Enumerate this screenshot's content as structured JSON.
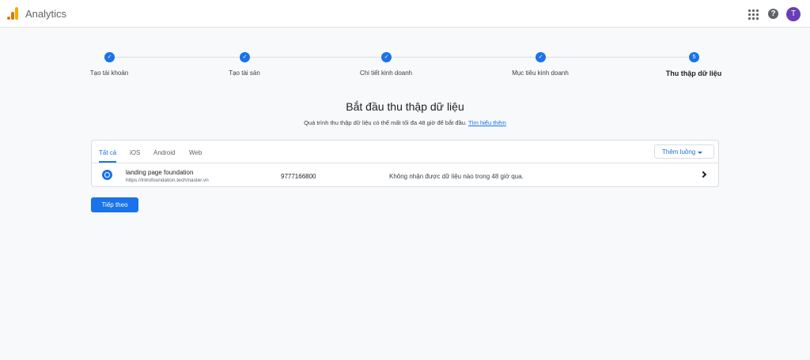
{
  "header": {
    "app_title": "Analytics",
    "avatar_initial": "T",
    "help_glyph": "?",
    "icons": [
      "analytics-logo-icon",
      "apps-grid-icon",
      "help-icon"
    ]
  },
  "stepper": {
    "check_glyph": "✓",
    "steps": [
      {
        "label": "Tạo tài khoản",
        "state": "done"
      },
      {
        "label": "Tạo tài sản",
        "state": "done"
      },
      {
        "label": "Chi tiết kinh doanh",
        "state": "done"
      },
      {
        "label": "Mục tiêu kinh doanh",
        "state": "done"
      },
      {
        "label": "Thu thập dữ liệu",
        "state": "active",
        "number": "5"
      }
    ]
  },
  "main": {
    "title": "Bắt đầu thu thập dữ liệu",
    "subtitle": "Quá trình thu thập dữ liệu có thể mất tối đa 48 giờ để bắt đầu.",
    "learn_more": "Tìm hiểu thêm"
  },
  "streams": {
    "tabs": [
      "Tất cả",
      "iOS",
      "Android",
      "Web"
    ],
    "active_tab": "Tất cả",
    "add_button": "Thêm luồng",
    "rows": [
      {
        "name": "landing page foundation",
        "url": "https://introfoundation.techmaster.vn",
        "id": "9777166800",
        "status": "Không nhận được dữ liệu nào trong 48 giờ qua.",
        "icon": "web-globe-icon"
      }
    ]
  },
  "footer": {
    "next_button": "Tiếp theo"
  },
  "colors": {
    "accent": "#1a73e8",
    "avatar": "#6a3db8",
    "logo_orange": "#e37400",
    "logo_yellow": "#f9ab00"
  }
}
